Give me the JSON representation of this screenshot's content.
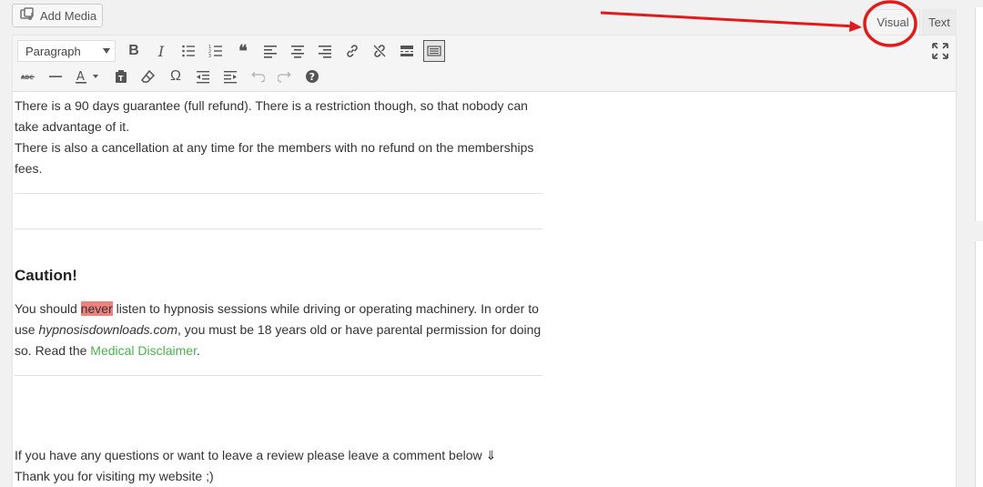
{
  "toolbar_top": {
    "add_media_label": "Add Media",
    "tabs": {
      "visual": "Visual",
      "text": "Text"
    }
  },
  "format_toolbar": {
    "format_select_value": "Paragraph",
    "row1_icons": [
      "bold-icon",
      "italic-icon",
      "bullet-list-icon",
      "numbered-list-icon",
      "blockquote-icon",
      "align-left-icon",
      "align-center-icon",
      "align-right-icon",
      "insert-link-icon",
      "remove-link-icon",
      "read-more-icon",
      "toolbar-toggle-icon",
      "fullscreen-icon"
    ],
    "row2_icons": [
      "strikethrough-icon",
      "horizontal-line-icon",
      "text-color-icon",
      "paste-text-icon",
      "clear-formatting-icon",
      "special-character-icon",
      "outdent-icon",
      "indent-icon",
      "undo-icon",
      "redo-icon",
      "help-icon"
    ],
    "bold_glyph": "B",
    "italic_glyph": "I",
    "blockquote_glyph": "❝",
    "omega_glyph": "Ω",
    "text_color_glyph": "A",
    "help_glyph": "?"
  },
  "content": {
    "guarantee_line1": "There is a 90 days guarantee (full refund). There is a restriction though, so that nobody can take advantage of it.",
    "guarantee_line2": "There is also a cancellation at any time for the members with no refund on the memberships fees.",
    "caution_heading": "Caution!",
    "caution_part1": "You should ",
    "caution_highlight": "never",
    "caution_part2": " listen to hypnosis sessions while driving or operating machinery. In order to use ",
    "caution_site": "hypnosisdownloads.com",
    "caution_part3": ", you must be 18 years old or have parental permission for doing so. Read the ",
    "caution_link": "Medical Disclaimer",
    "caution_end": ".",
    "closing_line1": "If you have any questions or want to leave a review please leave a comment below ⇓",
    "closing_line2": "Thank you for visiting my website ;)"
  },
  "colors": {
    "annotation_red": "#e11b1b",
    "highlight": "#f08080",
    "link_green": "#4caf50"
  }
}
